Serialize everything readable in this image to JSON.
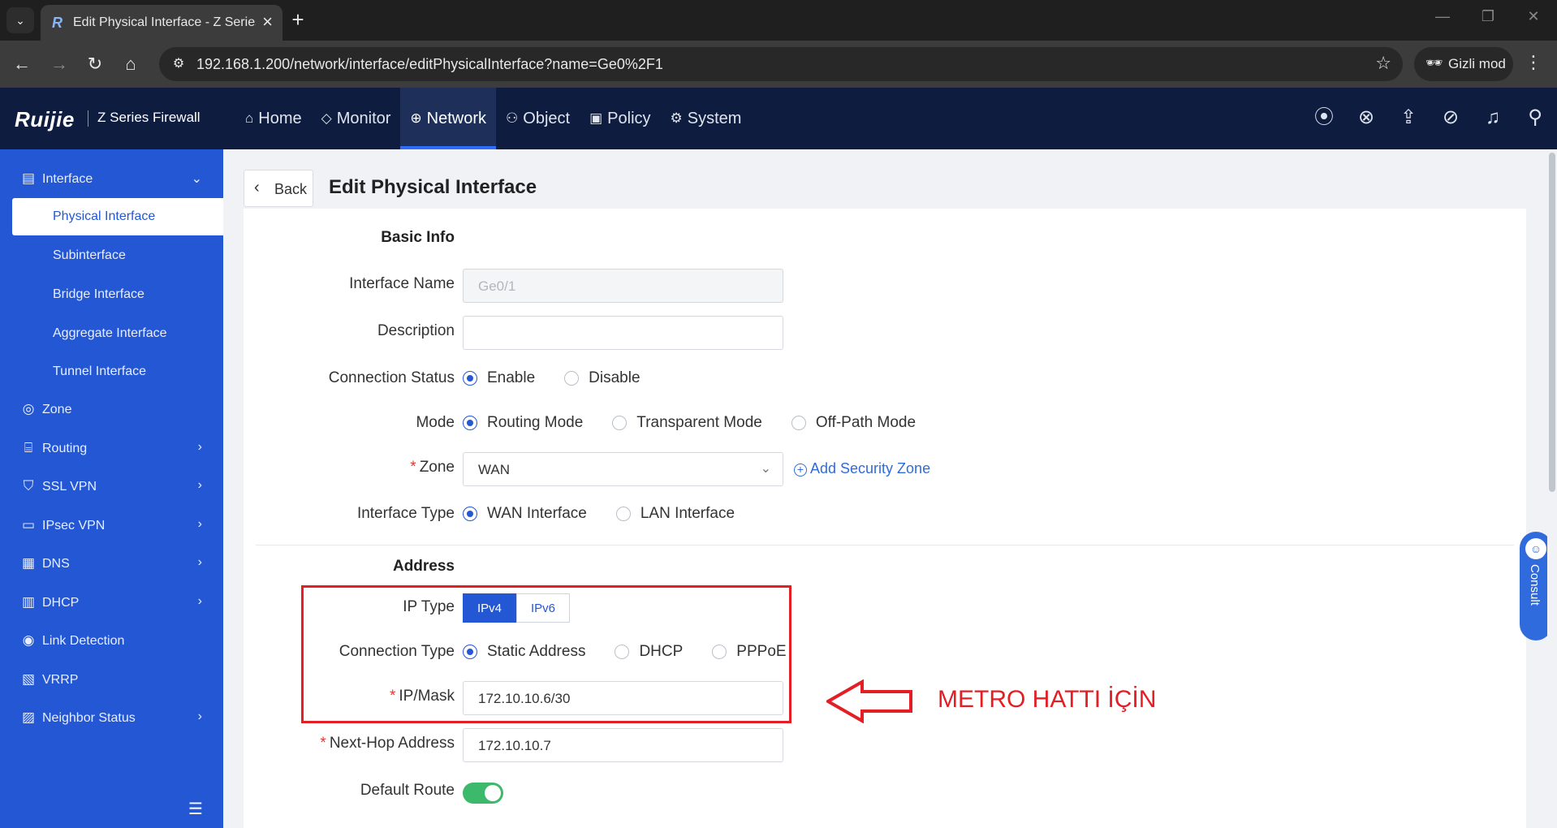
{
  "browser": {
    "tab_title": "Edit Physical Interface - Z Series",
    "url": "192.168.1.200/network/interface/editPhysicalInterface?name=Ge0%2F1",
    "incognito_label": "Gizli mod"
  },
  "header": {
    "logo": "Ruijie",
    "product": "Z Series Firewall",
    "nav": [
      {
        "label": "Home",
        "icon": "home-icon"
      },
      {
        "label": "Monitor",
        "icon": "shield-icon"
      },
      {
        "label": "Network",
        "icon": "globe-icon",
        "active": true
      },
      {
        "label": "Object",
        "icon": "user-icon"
      },
      {
        "label": "Policy",
        "icon": "policy-icon"
      },
      {
        "label": "System",
        "icon": "gear-icon"
      }
    ]
  },
  "sidebar": {
    "items": [
      {
        "label": "Interface",
        "icon": "interface-icon",
        "expanded": true
      },
      {
        "label": "Physical Interface",
        "active": true
      },
      {
        "label": "Subinterface"
      },
      {
        "label": "Bridge Interface"
      },
      {
        "label": "Aggregate Interface"
      },
      {
        "label": "Tunnel Interface"
      },
      {
        "label": "Zone",
        "icon": "zone-icon"
      },
      {
        "label": "Routing",
        "icon": "routing-icon"
      },
      {
        "label": "SSL VPN",
        "icon": "ssl-icon"
      },
      {
        "label": "IPsec VPN",
        "icon": "vpn-icon"
      },
      {
        "label": "DNS",
        "icon": "dns-icon"
      },
      {
        "label": "DHCP",
        "icon": "dhcp-icon"
      },
      {
        "label": "Link Detection",
        "icon": "link-detection-icon"
      },
      {
        "label": "VRRP",
        "icon": "vrrp-icon"
      },
      {
        "label": "Neighbor Status",
        "icon": "neighbor-icon"
      }
    ]
  },
  "page": {
    "back_label": "Back",
    "title": "Edit Physical Interface"
  },
  "form": {
    "basic_info_title": "Basic Info",
    "interface_name_label": "Interface Name",
    "interface_name_value": "Ge0/1",
    "description_label": "Description",
    "description_value": "",
    "connection_status_label": "Connection Status",
    "connection_status_options": [
      "Enable",
      "Disable"
    ],
    "mode_label": "Mode",
    "mode_options": [
      "Routing Mode",
      "Transparent Mode",
      "Off-Path Mode"
    ],
    "zone_label": "Zone",
    "zone_value": "WAN",
    "add_zone_label": "Add Security Zone",
    "interface_type_label": "Interface Type",
    "interface_type_options": [
      "WAN Interface",
      "LAN Interface"
    ],
    "address_title": "Address",
    "ip_type_label": "IP Type",
    "ip_type_options": [
      "IPv4",
      "IPv6"
    ],
    "connection_type_label": "Connection Type",
    "connection_type_options": [
      "Static Address",
      "DHCP",
      "PPPoE"
    ],
    "ip_mask_label": "IP/Mask",
    "ip_mask_value": "172.10.10.6/30",
    "next_hop_label": "Next-Hop Address",
    "next_hop_value": "172.10.10.7",
    "default_route_label": "Default Route",
    "default_route_on": true,
    "required_mark": "*"
  },
  "annotation": {
    "text": "METRO HATTI İÇİN",
    "color": "#e31e24"
  },
  "consult_label": "Consult",
  "colors": {
    "sidebar": "#2457d4",
    "header": "#0d1c3f",
    "accent": "#2457d4",
    "toggle_on": "#3cb96b"
  }
}
